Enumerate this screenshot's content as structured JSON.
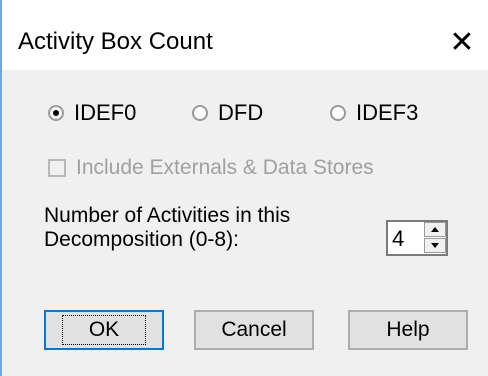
{
  "dialog": {
    "title": "Activity Box Count",
    "close_symbol": "✕"
  },
  "methodology": {
    "options": [
      {
        "label": "IDEF0",
        "checked": true
      },
      {
        "label": "DFD",
        "checked": false
      },
      {
        "label": "IDEF3",
        "checked": false
      }
    ]
  },
  "include_externals": {
    "label": "Include Externals & Data Stores",
    "checked": false,
    "enabled": false
  },
  "activities": {
    "label_line1": "Number of Activities in this",
    "label_line2": "Decomposition (0-8):",
    "value": "4"
  },
  "buttons": {
    "ok": "OK",
    "cancel": "Cancel",
    "help": "Help"
  }
}
